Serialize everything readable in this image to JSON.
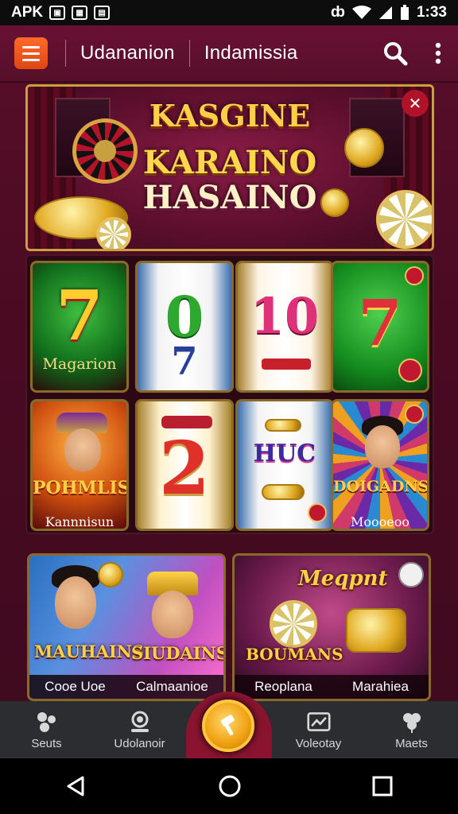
{
  "status_bar": {
    "left_text": "APK",
    "time": "1:33"
  },
  "top_bar": {
    "brand": "Udananion",
    "title": "Indamissia"
  },
  "banner": {
    "line1": "KASGINE",
    "line2": "KARAINO",
    "line3": "HASAINO"
  },
  "games": [
    {
      "glyph": "7",
      "label": "Magarion"
    },
    {
      "glyph": "0",
      "label": ""
    },
    {
      "glyph": "10",
      "label": ""
    },
    {
      "glyph": "7",
      "label": ""
    },
    {
      "glyph": "",
      "title": "POHMLIS",
      "label": "Kannnisun"
    },
    {
      "glyph": "2",
      "label": ""
    },
    {
      "glyph": "",
      "title": "HUC",
      "label": ""
    },
    {
      "glyph": "",
      "title": "DOIGADNS",
      "label": "Moooeoo"
    }
  ],
  "featured": [
    {
      "title_left": "MAUHAINS",
      "title_right": "SIUDAINS",
      "cap_left": "Cooe Uoe",
      "cap_right": "Calmaanioe"
    },
    {
      "title_top": "Meqpnt",
      "title_bottom": "BOUMANS",
      "cap_left": "Reoplana",
      "cap_right": "Marahiea"
    }
  ],
  "bottom_nav": {
    "items": [
      {
        "label": "Seuts",
        "icon": "puzzle-icon"
      },
      {
        "label": "Udolanoir",
        "icon": "user-icon"
      },
      {
        "label": "",
        "icon": "hammer-icon"
      },
      {
        "label": "Voleotay",
        "icon": "image-icon"
      },
      {
        "label": "Maets",
        "icon": "clover-icon"
      }
    ]
  },
  "colors": {
    "accent": "#e04512",
    "gold": "#ffd046",
    "maroon": "#5a0f2a"
  }
}
